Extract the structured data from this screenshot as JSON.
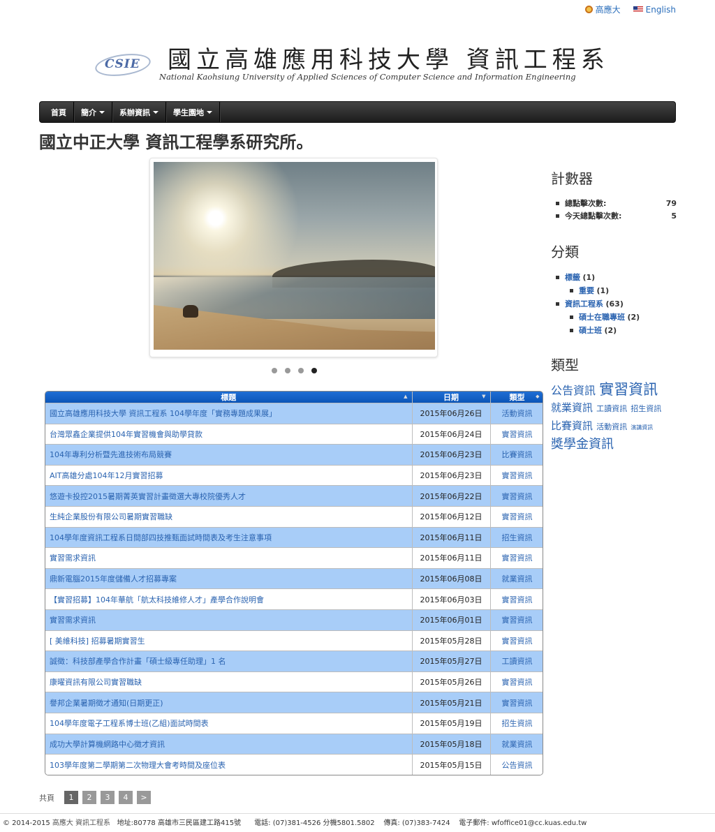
{
  "toplinks": {
    "kuas": "高應大",
    "english": "English"
  },
  "banner": {
    "logo_text": "CSIE",
    "cn_title": "國立高雄應用科技大學 資訊工程系",
    "en_title": "National Kaohsiung University of Applied Sciences of Computer Science and Information Engineering"
  },
  "nav": [
    {
      "label": "首頁",
      "dropdown": false
    },
    {
      "label": "簡介",
      "dropdown": true
    },
    {
      "label": "系辦資訊",
      "dropdown": true
    },
    {
      "label": "學生園地",
      "dropdown": true
    }
  ],
  "heading": "國立中正大學 資訊工程學系研究所。",
  "slider": {
    "dots": 4,
    "active": 3
  },
  "table": {
    "headers": [
      "標題",
      "日期",
      "類型"
    ],
    "rows": [
      {
        "title": "國立高雄應用科技大學 資訊工程系 104學年度「實務專題成果展」",
        "date": "2015年06月26日",
        "type": "活動資訊"
      },
      {
        "title": "台灣眾鑫企業提供104年實習機會與助學貸款",
        "date": "2015年06月24日",
        "type": "實習資訊"
      },
      {
        "title": "104年專利分析暨先進技術布局競賽",
        "date": "2015年06月23日",
        "type": "比賽資訊"
      },
      {
        "title": "AIT高雄分處104年12月實習招募",
        "date": "2015年06月23日",
        "type": "實習資訊"
      },
      {
        "title": "悠遊卡投控2015暑期菁英實習計畫徵選大專校院優秀人才",
        "date": "2015年06月22日",
        "type": "實習資訊"
      },
      {
        "title": "生純企業股份有限公司暑期實習職缺",
        "date": "2015年06月12日",
        "type": "實習資訊"
      },
      {
        "title": "104學年度資訊工程系日間部四技推甄面試時間表及考生注意事項",
        "date": "2015年06月11日",
        "type": "招生資訊"
      },
      {
        "title": "實習需求資訊",
        "date": "2015年06月11日",
        "type": "實習資訊"
      },
      {
        "title": "鼎新電腦2015年度儲備人才招募專案",
        "date": "2015年06月08日",
        "type": "就業資訊"
      },
      {
        "title": "【實習招募】104年華航「航太科技維修人才」產學合作說明會",
        "date": "2015年06月03日",
        "type": "實習資訊"
      },
      {
        "title": "實習需求資訊",
        "date": "2015年06月01日",
        "type": "實習資訊"
      },
      {
        "title": "[ 美維科技] 招募暑期實習生",
        "date": "2015年05月28日",
        "type": "實習資訊"
      },
      {
        "title": "誠徵：科技部產學合作計畫「碩士級專任助理」1 名",
        "date": "2015年05月27日",
        "type": "工讀資訊"
      },
      {
        "title": "康曜資訊有限公司實習職缺",
        "date": "2015年05月26日",
        "type": "實習資訊"
      },
      {
        "title": "譽邦企業暑期徵才通知(日期更正)",
        "date": "2015年05月21日",
        "type": "實習資訊"
      },
      {
        "title": "104學年度電子工程系博士班(乙組)面試時間表",
        "date": "2015年05月19日",
        "type": "招生資訊"
      },
      {
        "title": "成功大學計算機網路中心徵才資訊",
        "date": "2015年05月18日",
        "type": "就業資訊"
      },
      {
        "title": "103學年度第二學期第二次物理大會考時間及座位表",
        "date": "2015年05月15日",
        "type": "公告資訊"
      }
    ]
  },
  "pager": {
    "label": "共頁",
    "pages": [
      "1",
      "2",
      "3",
      "4"
    ],
    "next": ">"
  },
  "footer": {
    "copyright": "© 2014-2015",
    "link": "高應大 資訊工程系",
    "address": "地址:80778 高雄市三民區建工路415號",
    "phone": "電話: (07)381-4526 分機5801.5802",
    "fax": "傳真: (07)383-7424",
    "email": "電子郵件: wfoffice01@cc.kuas.edu.tw"
  },
  "sidebar": {
    "counter_title": "計數器",
    "counter": [
      {
        "label": "總點擊次數:",
        "value": "79"
      },
      {
        "label": "今天總點擊次數:",
        "value": "5"
      }
    ],
    "category_title": "分類",
    "categories": [
      {
        "label": "標籤",
        "count": "(1)",
        "level": 0
      },
      {
        "label": "重要",
        "count": "(1)",
        "level": 1
      },
      {
        "label": "資訊工程系",
        "count": "(63)",
        "level": 0
      },
      {
        "label": "碩士在職專班",
        "count": "(2)",
        "level": 1
      },
      {
        "label": "碩士班",
        "count": "(2)",
        "level": 1
      }
    ],
    "type_title": "類型",
    "tags": [
      {
        "label": "公告資訊",
        "size": "t16"
      },
      {
        "label": "實習資訊",
        "size": "t21"
      },
      {
        "label": "就業資訊",
        "size": "t15"
      },
      {
        "label": "工讀資訊",
        "size": "t11"
      },
      {
        "label": "招生資訊",
        "size": "t11"
      },
      {
        "label": "比賽資訊",
        "size": "t15"
      },
      {
        "label": "活動資訊",
        "size": "t11"
      },
      {
        "label": "演講資訊",
        "size": "t8"
      },
      {
        "label": "獎學金資訊",
        "size": "t18"
      }
    ]
  },
  "colors": {
    "link": "#2a63b0",
    "table_header": "#0b55b8",
    "row_highlight": "#a8cdf8",
    "navbar": "#1c1c1c"
  }
}
